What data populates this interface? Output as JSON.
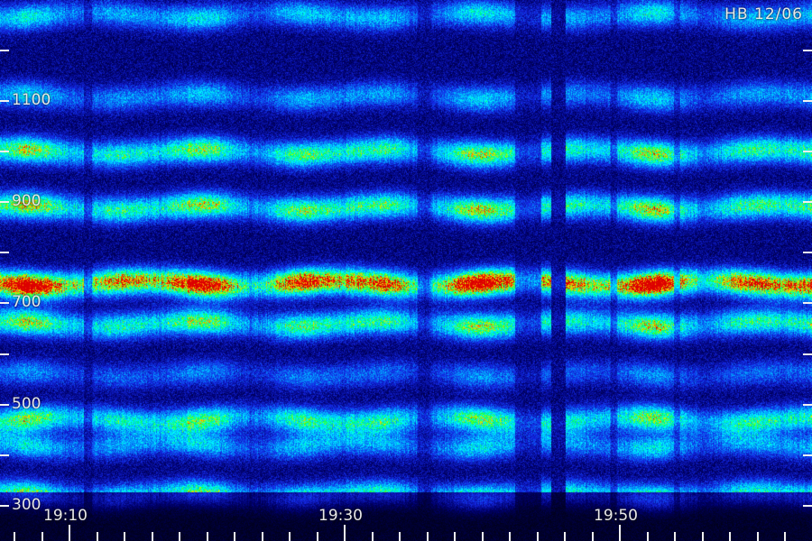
{
  "chart_data": {
    "type": "heatmap",
    "title": "",
    "xlabel": "",
    "ylabel": "",
    "annotation": "HB 12/06",
    "x_tick_labels": [
      "19:10",
      "19:30",
      "19:50"
    ],
    "y_tick_labels": [
      "1100",
      "900",
      "700",
      "500",
      "300"
    ],
    "x_tick_values_min": [
      70,
      90,
      110
    ],
    "y_tick_values": [
      1100,
      900,
      700,
      500,
      300
    ],
    "xlim_min": [
      65,
      124
    ],
    "ylim": [
      230,
      1300
    ],
    "x_minor_tick_step_min": 2,
    "y_tick_step": 100,
    "gap_min": [
      105.0,
      105.4
    ],
    "bands": [
      {
        "freq": 1000,
        "level": 0.55
      },
      {
        "freq": 890,
        "level": 0.58
      },
      {
        "freq": 740,
        "level": 0.95
      },
      {
        "freq": 660,
        "level": 0.55
      },
      {
        "freq": 560,
        "level": 0.22
      },
      {
        "freq": 470,
        "level": 0.52
      },
      {
        "freq": 420,
        "level": 0.33
      },
      {
        "freq": 320,
        "level": 0.52
      },
      {
        "freq": 1110,
        "level": 0.3
      },
      {
        "freq": 1270,
        "level": 0.35
      }
    ],
    "colors": {
      "low": "#000080",
      "mid": "#00ffff",
      "high": "#00ff40",
      "peak": "#ff2000"
    }
  }
}
